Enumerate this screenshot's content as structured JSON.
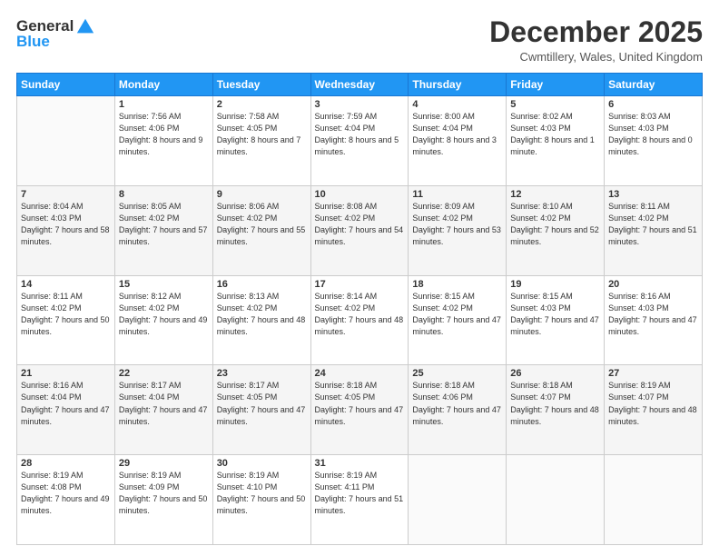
{
  "logo": {
    "general": "General",
    "blue": "Blue"
  },
  "header": {
    "month": "December 2025",
    "location": "Cwmtillery, Wales, United Kingdom"
  },
  "days_of_week": [
    "Sunday",
    "Monday",
    "Tuesday",
    "Wednesday",
    "Thursday",
    "Friday",
    "Saturday"
  ],
  "weeks": [
    [
      {
        "day": "",
        "sunrise": "",
        "sunset": "",
        "daylight": ""
      },
      {
        "day": "1",
        "sunrise": "Sunrise: 7:56 AM",
        "sunset": "Sunset: 4:06 PM",
        "daylight": "Daylight: 8 hours and 9 minutes."
      },
      {
        "day": "2",
        "sunrise": "Sunrise: 7:58 AM",
        "sunset": "Sunset: 4:05 PM",
        "daylight": "Daylight: 8 hours and 7 minutes."
      },
      {
        "day": "3",
        "sunrise": "Sunrise: 7:59 AM",
        "sunset": "Sunset: 4:04 PM",
        "daylight": "Daylight: 8 hours and 5 minutes."
      },
      {
        "day": "4",
        "sunrise": "Sunrise: 8:00 AM",
        "sunset": "Sunset: 4:04 PM",
        "daylight": "Daylight: 8 hours and 3 minutes."
      },
      {
        "day": "5",
        "sunrise": "Sunrise: 8:02 AM",
        "sunset": "Sunset: 4:03 PM",
        "daylight": "Daylight: 8 hours and 1 minute."
      },
      {
        "day": "6",
        "sunrise": "Sunrise: 8:03 AM",
        "sunset": "Sunset: 4:03 PM",
        "daylight": "Daylight: 8 hours and 0 minutes."
      }
    ],
    [
      {
        "day": "7",
        "sunrise": "Sunrise: 8:04 AM",
        "sunset": "Sunset: 4:03 PM",
        "daylight": "Daylight: 7 hours and 58 minutes."
      },
      {
        "day": "8",
        "sunrise": "Sunrise: 8:05 AM",
        "sunset": "Sunset: 4:02 PM",
        "daylight": "Daylight: 7 hours and 57 minutes."
      },
      {
        "day": "9",
        "sunrise": "Sunrise: 8:06 AM",
        "sunset": "Sunset: 4:02 PM",
        "daylight": "Daylight: 7 hours and 55 minutes."
      },
      {
        "day": "10",
        "sunrise": "Sunrise: 8:08 AM",
        "sunset": "Sunset: 4:02 PM",
        "daylight": "Daylight: 7 hours and 54 minutes."
      },
      {
        "day": "11",
        "sunrise": "Sunrise: 8:09 AM",
        "sunset": "Sunset: 4:02 PM",
        "daylight": "Daylight: 7 hours and 53 minutes."
      },
      {
        "day": "12",
        "sunrise": "Sunrise: 8:10 AM",
        "sunset": "Sunset: 4:02 PM",
        "daylight": "Daylight: 7 hours and 52 minutes."
      },
      {
        "day": "13",
        "sunrise": "Sunrise: 8:11 AM",
        "sunset": "Sunset: 4:02 PM",
        "daylight": "Daylight: 7 hours and 51 minutes."
      }
    ],
    [
      {
        "day": "14",
        "sunrise": "Sunrise: 8:11 AM",
        "sunset": "Sunset: 4:02 PM",
        "daylight": "Daylight: 7 hours and 50 minutes."
      },
      {
        "day": "15",
        "sunrise": "Sunrise: 8:12 AM",
        "sunset": "Sunset: 4:02 PM",
        "daylight": "Daylight: 7 hours and 49 minutes."
      },
      {
        "day": "16",
        "sunrise": "Sunrise: 8:13 AM",
        "sunset": "Sunset: 4:02 PM",
        "daylight": "Daylight: 7 hours and 48 minutes."
      },
      {
        "day": "17",
        "sunrise": "Sunrise: 8:14 AM",
        "sunset": "Sunset: 4:02 PM",
        "daylight": "Daylight: 7 hours and 48 minutes."
      },
      {
        "day": "18",
        "sunrise": "Sunrise: 8:15 AM",
        "sunset": "Sunset: 4:02 PM",
        "daylight": "Daylight: 7 hours and 47 minutes."
      },
      {
        "day": "19",
        "sunrise": "Sunrise: 8:15 AM",
        "sunset": "Sunset: 4:03 PM",
        "daylight": "Daylight: 7 hours and 47 minutes."
      },
      {
        "day": "20",
        "sunrise": "Sunrise: 8:16 AM",
        "sunset": "Sunset: 4:03 PM",
        "daylight": "Daylight: 7 hours and 47 minutes."
      }
    ],
    [
      {
        "day": "21",
        "sunrise": "Sunrise: 8:16 AM",
        "sunset": "Sunset: 4:04 PM",
        "daylight": "Daylight: 7 hours and 47 minutes."
      },
      {
        "day": "22",
        "sunrise": "Sunrise: 8:17 AM",
        "sunset": "Sunset: 4:04 PM",
        "daylight": "Daylight: 7 hours and 47 minutes."
      },
      {
        "day": "23",
        "sunrise": "Sunrise: 8:17 AM",
        "sunset": "Sunset: 4:05 PM",
        "daylight": "Daylight: 7 hours and 47 minutes."
      },
      {
        "day": "24",
        "sunrise": "Sunrise: 8:18 AM",
        "sunset": "Sunset: 4:05 PM",
        "daylight": "Daylight: 7 hours and 47 minutes."
      },
      {
        "day": "25",
        "sunrise": "Sunrise: 8:18 AM",
        "sunset": "Sunset: 4:06 PM",
        "daylight": "Daylight: 7 hours and 47 minutes."
      },
      {
        "day": "26",
        "sunrise": "Sunrise: 8:18 AM",
        "sunset": "Sunset: 4:07 PM",
        "daylight": "Daylight: 7 hours and 48 minutes."
      },
      {
        "day": "27",
        "sunrise": "Sunrise: 8:19 AM",
        "sunset": "Sunset: 4:07 PM",
        "daylight": "Daylight: 7 hours and 48 minutes."
      }
    ],
    [
      {
        "day": "28",
        "sunrise": "Sunrise: 8:19 AM",
        "sunset": "Sunset: 4:08 PM",
        "daylight": "Daylight: 7 hours and 49 minutes."
      },
      {
        "day": "29",
        "sunrise": "Sunrise: 8:19 AM",
        "sunset": "Sunset: 4:09 PM",
        "daylight": "Daylight: 7 hours and 50 minutes."
      },
      {
        "day": "30",
        "sunrise": "Sunrise: 8:19 AM",
        "sunset": "Sunset: 4:10 PM",
        "daylight": "Daylight: 7 hours and 50 minutes."
      },
      {
        "day": "31",
        "sunrise": "Sunrise: 8:19 AM",
        "sunset": "Sunset: 4:11 PM",
        "daylight": "Daylight: 7 hours and 51 minutes."
      },
      {
        "day": "",
        "sunrise": "",
        "sunset": "",
        "daylight": ""
      },
      {
        "day": "",
        "sunrise": "",
        "sunset": "",
        "daylight": ""
      },
      {
        "day": "",
        "sunrise": "",
        "sunset": "",
        "daylight": ""
      }
    ]
  ]
}
